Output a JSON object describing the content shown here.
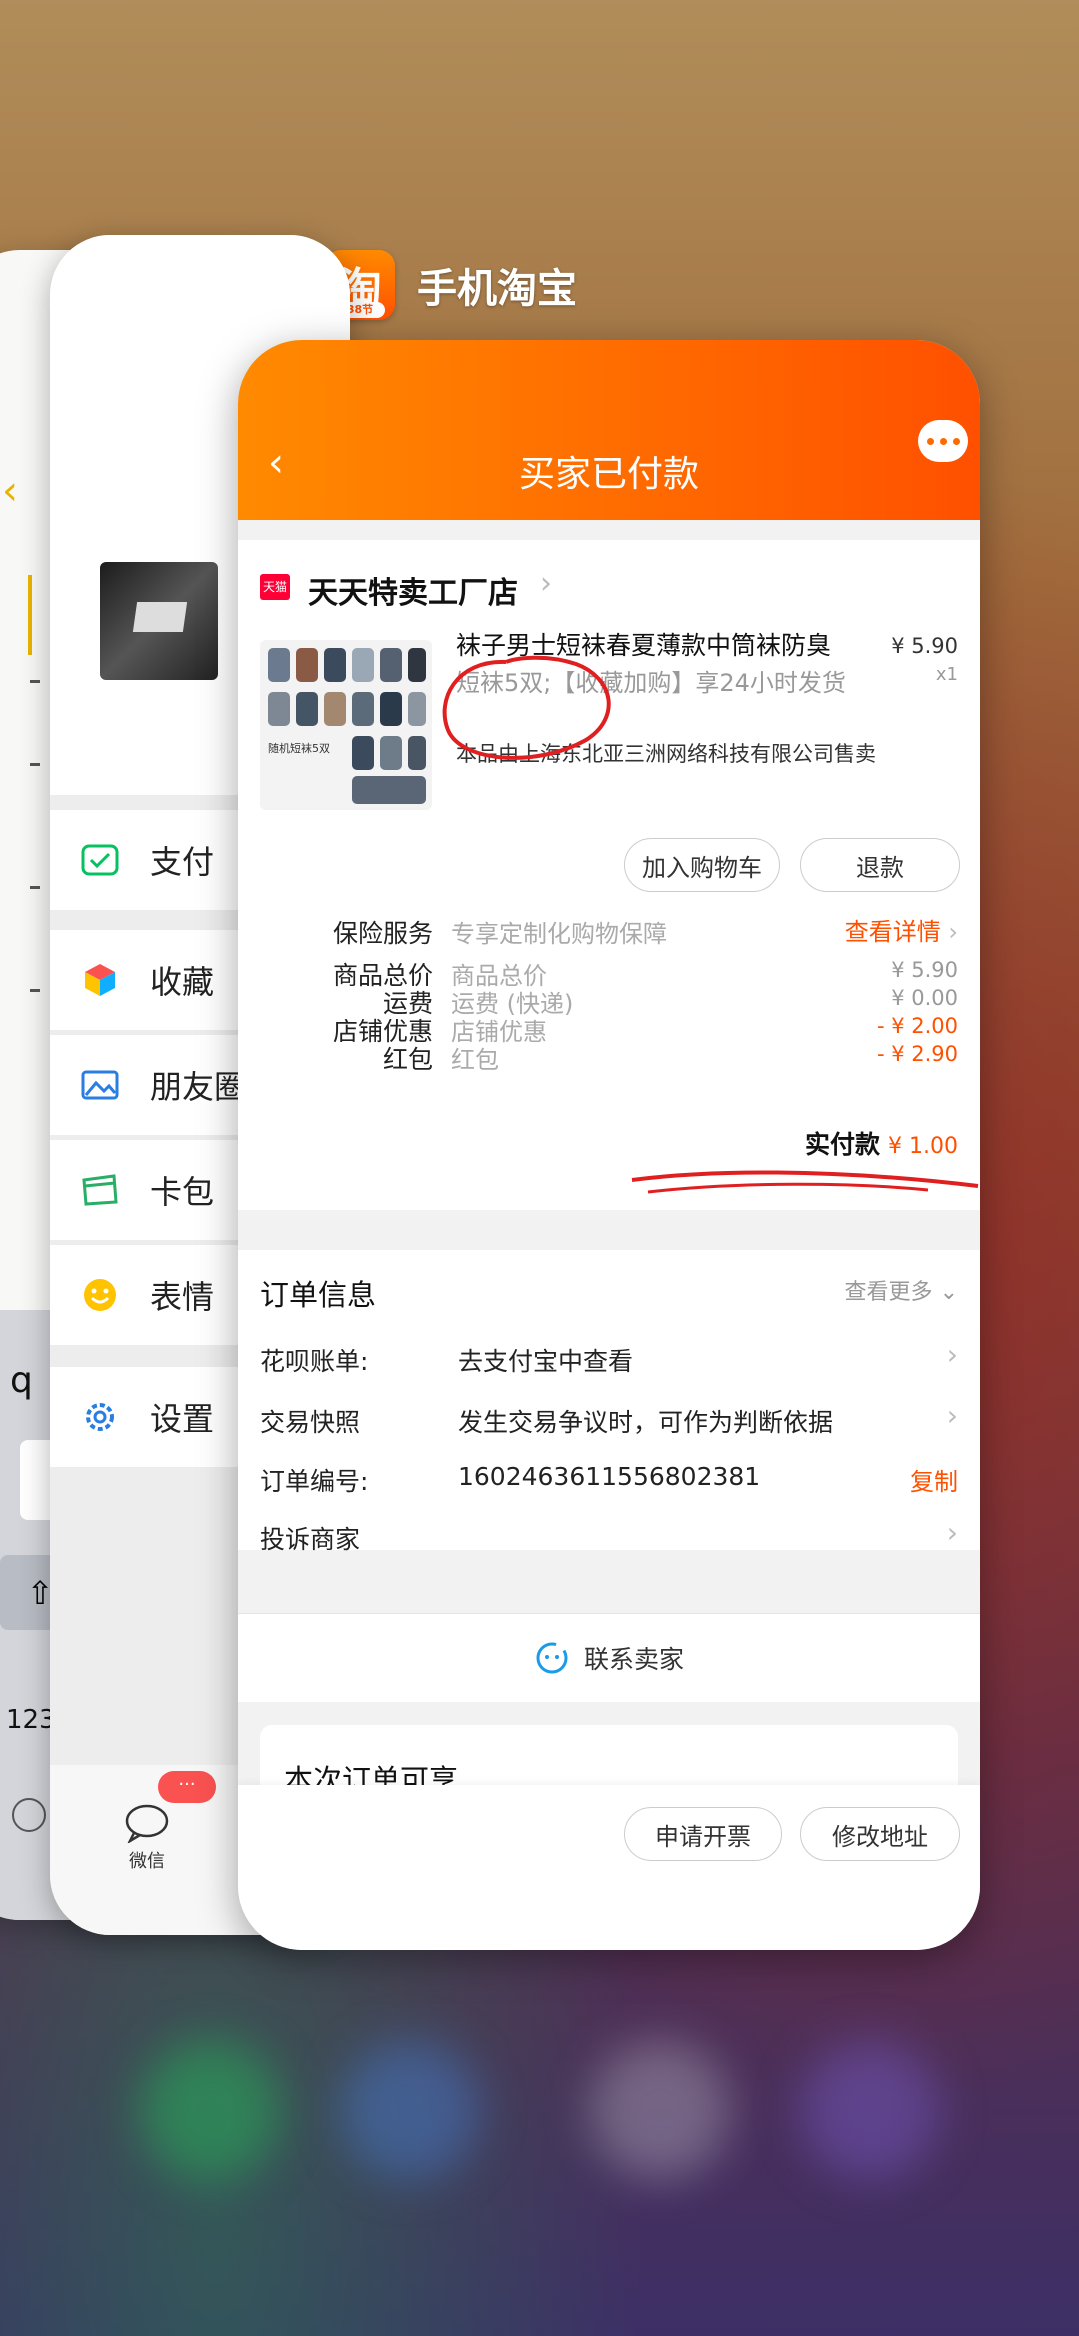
{
  "switcher": {
    "taobao_title": "手机淘宝",
    "taobao_badge": "38节"
  },
  "notes_card": {
    "texts": [
      "<",
      "q",
      "123",
      "0",
      "Q"
    ]
  },
  "wechat_card": {
    "menu": [
      {
        "label": "支付",
        "icon": "wechat-pay-icon"
      },
      {
        "label": "收藏",
        "icon": "favorites-cube-icon"
      },
      {
        "label": "朋友圈",
        "icon": "moments-image-icon"
      },
      {
        "label": "卡包",
        "icon": "card-wallet-icon"
      },
      {
        "label": "表情",
        "icon": "emoji-smile-icon"
      },
      {
        "label": "设置",
        "icon": "gear-icon"
      }
    ],
    "tab_wechat": "微信",
    "tab_badge": "···"
  },
  "taobao": {
    "header_title": "买家已付款",
    "store": {
      "tmall_tag": "天猫",
      "name": "天天特卖工厂店"
    },
    "product": {
      "title": "袜子男士短袜春夏薄款中筒袜防臭",
      "spec": "短袜5双;【收藏加购】享24小时发货",
      "seller": "本品由上海东北亚三洲网络科技有限公司售卖",
      "price": "¥ 5.90",
      "qty": "x1",
      "thumb_caption": "随机短袜5双"
    },
    "buttons": {
      "add_cart": "加入购物车",
      "refund": "退款"
    },
    "insurance": {
      "label": "保险服务",
      "value": "专享定制化购物保障",
      "link": "查看详情"
    },
    "price_rows": [
      {
        "label": "商品总价",
        "value": "商品总价",
        "amount": "¥ 5.90",
        "highlight": false
      },
      {
        "label": "运费",
        "value": "运费 (快递)",
        "amount": "¥ 0.00",
        "highlight": false
      },
      {
        "label": "店铺优惠",
        "value": "店铺优惠",
        "amount": "- ¥ 2.00",
        "highlight": true
      },
      {
        "label": "红包",
        "value": "红包",
        "amount": "- ¥ 2.90",
        "highlight": true
      }
    ],
    "paid": {
      "label": "实付款",
      "amount": "¥ 1.00"
    },
    "order_info": {
      "title": "订单信息",
      "more": "查看更多",
      "rows": [
        {
          "label": "花呗账单:",
          "value": "去支付宝中查看"
        },
        {
          "label": "交易快照",
          "value": "发生交易争议时，可作为判断依据"
        },
        {
          "label": "订单编号:",
          "value": "1602463611556802381",
          "action": "复制"
        },
        {
          "label": "投诉商家",
          "value": ""
        }
      ]
    },
    "contact_seller": "联系卖家",
    "benefits_title": "本次订单可享",
    "bottom_buttons": {
      "invoice": "申请开票",
      "change_address": "修改地址"
    },
    "colors": {
      "accent": "#ff5000",
      "header_start": "#ff8a00",
      "annotation_red": "#e02020"
    }
  }
}
